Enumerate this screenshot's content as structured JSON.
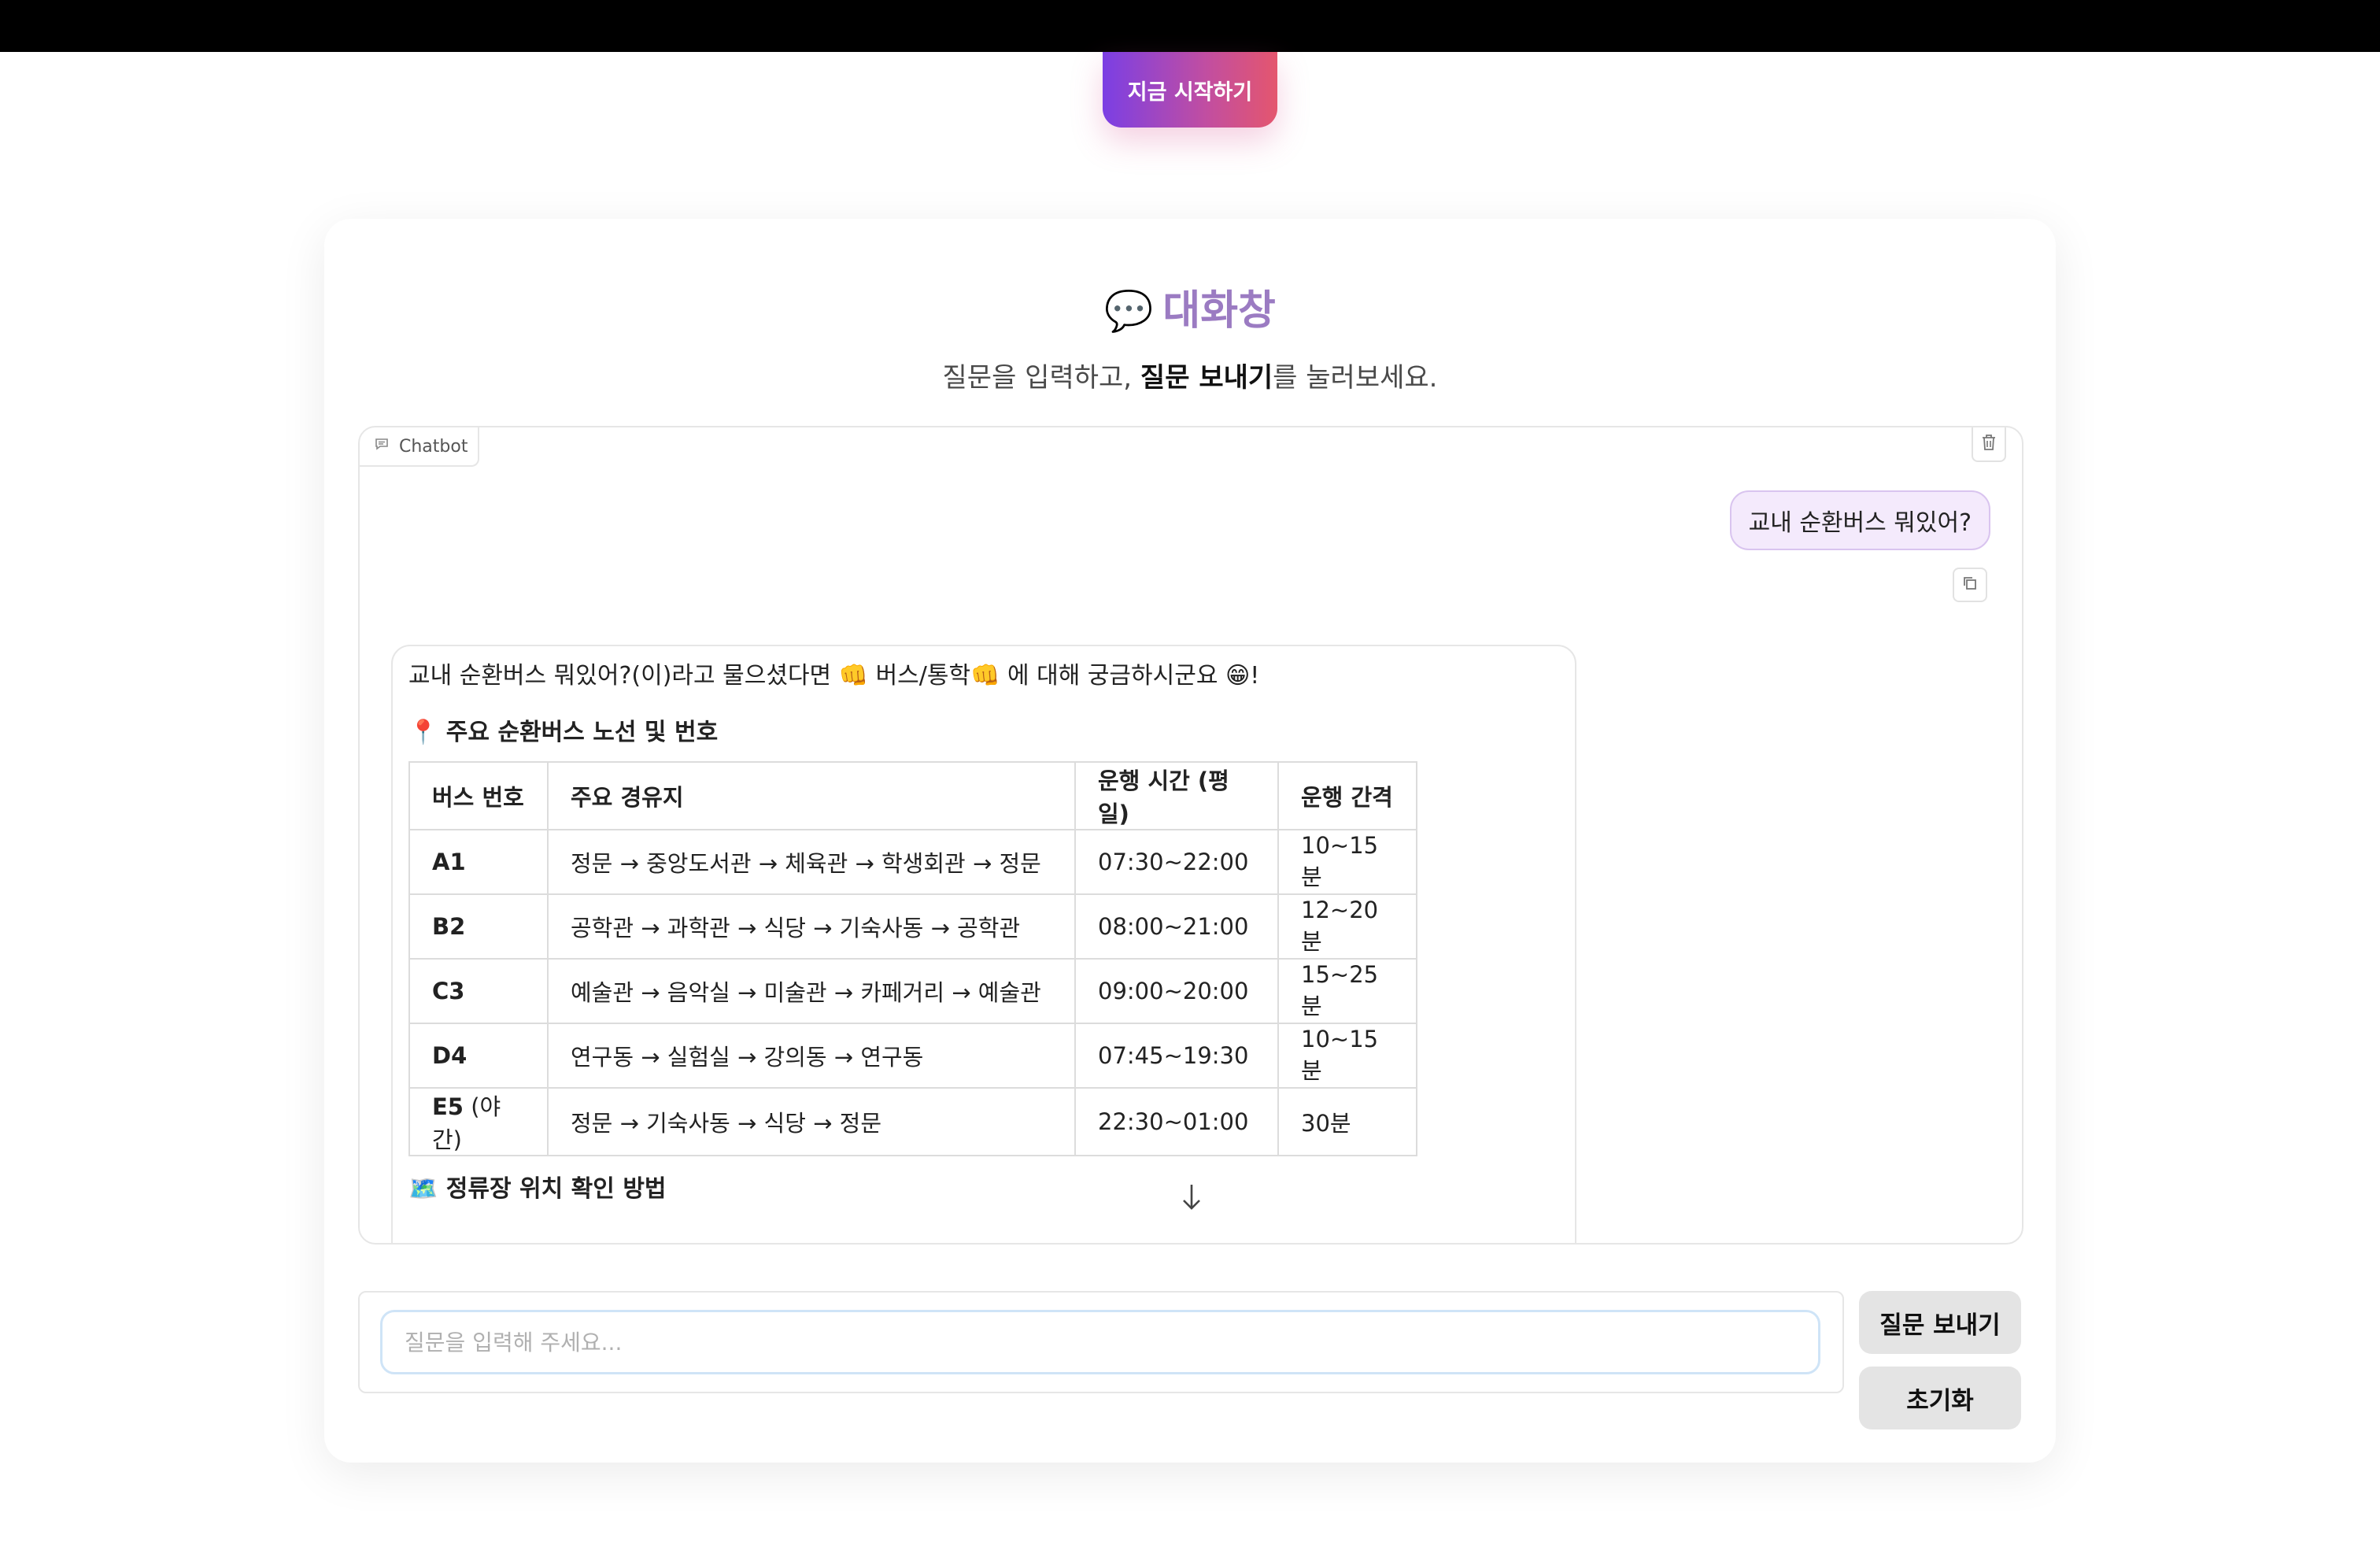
{
  "hero": {
    "start_label": "지금 시작하기"
  },
  "header": {
    "title_emoji": "💬",
    "title": "대화창",
    "subtitle_pre": "질문을 입력하고, ",
    "subtitle_bold": "질문 보내기",
    "subtitle_post": "를 눌러보세요."
  },
  "chatbot": {
    "label": "Chatbot",
    "user_message": "교내 순환버스 뭐있어?",
    "bot": {
      "intro": "교내 순환버스 뭐있어?(이)라고 물으셨다면 👊 버스/통학👊 에 대해 궁금하시군요 😁!",
      "section1": "📍 주요 순환버스 노선 및 번호",
      "table": {
        "headers": [
          "버스 번호",
          "주요 경유지",
          "운행 시간 (평일)",
          "운행 간격"
        ],
        "rows": [
          {
            "bus": "A1",
            "suffix": "",
            "route": "정문 → 중앙도서관 → 체육관 → 학생회관 → 정문",
            "time": "07:30~22:00",
            "interval": "10~15분"
          },
          {
            "bus": "B2",
            "suffix": "",
            "route": "공학관 → 과학관 → 식당 → 기숙사동 → 공학관",
            "time": "08:00~21:00",
            "interval": "12~20분"
          },
          {
            "bus": "C3",
            "suffix": "",
            "route": "예술관 → 음악실 → 미술관 → 카페거리 → 예술관",
            "time": "09:00~20:00",
            "interval": "15~25분"
          },
          {
            "bus": "D4",
            "suffix": "",
            "route": "연구동 → 실험실 → 강의동 → 연구동",
            "time": "07:45~19:30",
            "interval": "10~15분"
          },
          {
            "bus": "E5",
            "suffix": " (야간)",
            "route": "정문 → 기숙사동 → 식당 → 정문",
            "time": "22:30~01:00",
            "interval": "30분"
          }
        ]
      },
      "section2": "🗺️ 정류장 위치 확인 방법"
    }
  },
  "input": {
    "placeholder": "질문을 입력해 주세요..."
  },
  "buttons": {
    "send": "질문 보내기",
    "reset": "초기화"
  },
  "colors": {
    "title_purple": "#9b7bc2",
    "start_gradient_from": "#7b3fe4",
    "start_gradient_to": "#e4566e",
    "user_bubble_bg": "#f4eafc",
    "button_gray": "#e4e4e4"
  },
  "icons": {
    "chat_label_icon": "chat-bubble-icon",
    "trash": "trash-icon",
    "copy": "copy-icon",
    "scroll": "arrow-down-icon"
  }
}
